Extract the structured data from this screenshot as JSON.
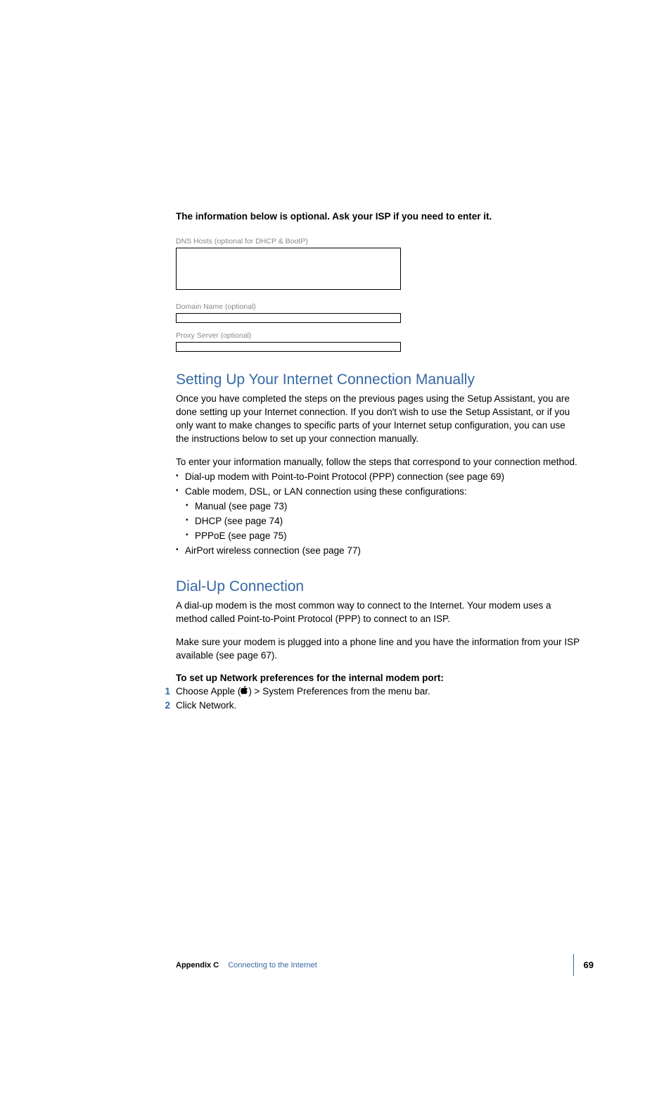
{
  "optionalInfo": "The information below is optional. Ask your ISP if you need to enter it.",
  "formLabels": {
    "dnsHosts": "DNS Hosts (optional for DHCP & BootP)",
    "domainName": "Domain Name (optional)",
    "proxyServer": "Proxy Server (optional)"
  },
  "section1": {
    "heading": "Setting Up Your Internet Connection Manually",
    "para1": "Once you have completed the steps on the previous pages using the Setup Assistant, you are done setting up your Internet connection. If you don't wish to use the Setup Assistant, or if you only want to make changes to specific parts of your Internet setup configuration, you can use the instructions below to set up your connection manually.",
    "para2": "To enter your information manually, follow the steps that correspond to your connection method.",
    "bullets": [
      "Dial-up modem with Point-to-Point Protocol (PPP) connection (see page 69)",
      "Cable modem, DSL, or LAN connection using these configurations:"
    ],
    "nestedBullets": [
      "Manual (see page 73)",
      "DHCP (see page 74)",
      "PPPoE (see page 75)"
    ],
    "bulletsAfter": [
      "AirPort wireless connection (see page 77)"
    ]
  },
  "section2": {
    "heading": "Dial-Up Connection",
    "para1": "A dial-up modem is the most common way to connect to the Internet. Your modem uses a method called Point-to-Point Protocol (PPP) to connect to an ISP.",
    "para2": "Make sure your modem is plugged into a phone line and you have the information from your ISP available (see page 67).",
    "subheading": "To set up Network preferences for the internal modem port:",
    "step1Num": "1",
    "step1Pre": "Choose Apple (",
    "step1Post": ") > System Preferences from the menu bar.",
    "step2Num": "2",
    "step2": "Click Network."
  },
  "footer": {
    "appendixLabel": "Appendix C",
    "appendixTitle": "Connecting to the Internet",
    "pageNum": "69"
  }
}
